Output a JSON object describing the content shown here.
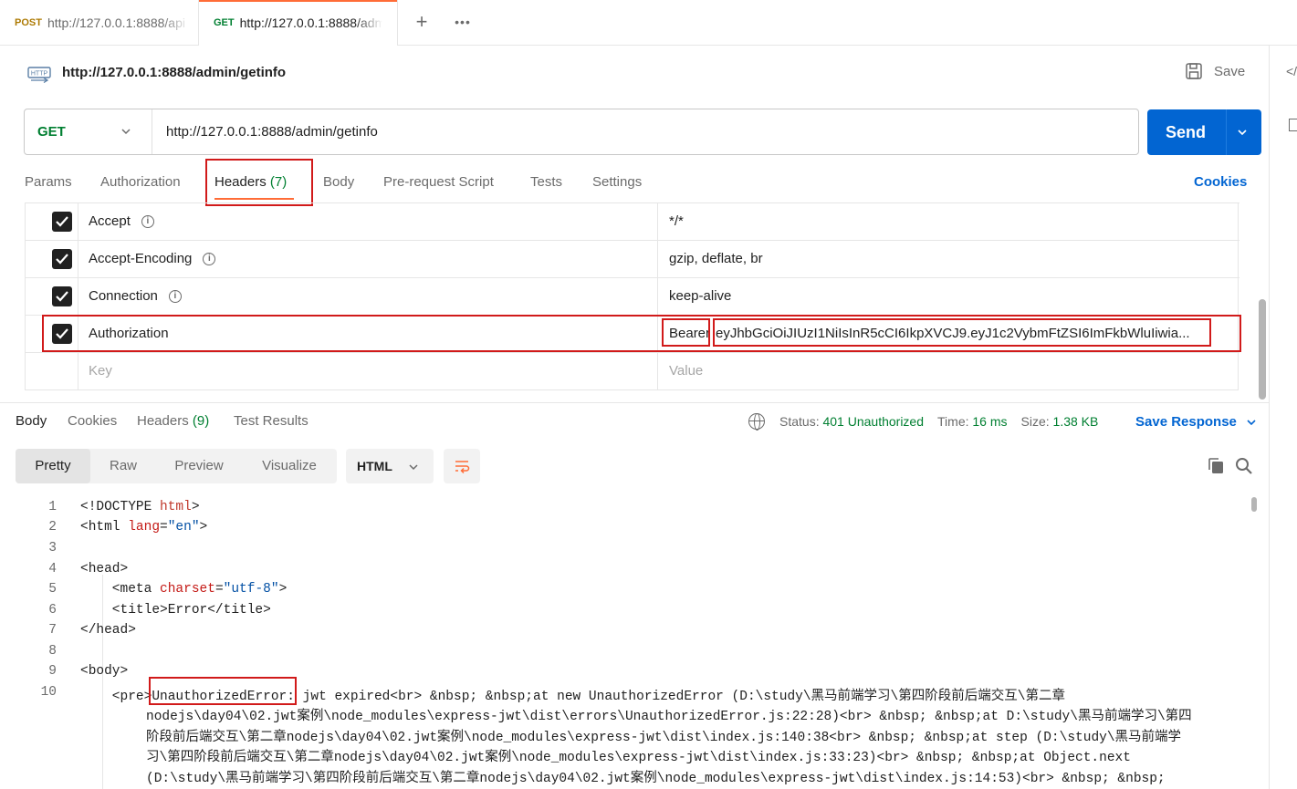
{
  "tabs": [
    {
      "method": "POST",
      "url": "http://127.0.0.1:8888/api"
    },
    {
      "method": "GET",
      "url": "http://127.0.0.1:8888/adm"
    }
  ],
  "tab_add_icon": "plus-icon",
  "tab_more_icon": "more-icon",
  "request": {
    "icon": "HTTP",
    "title": "http://127.0.0.1:8888/admin/getinfo",
    "save_label": "Save",
    "method": "GET",
    "url": "http://127.0.0.1:8888/admin/getinfo",
    "send_label": "Send"
  },
  "request_tabs": {
    "params": "Params",
    "authorization": "Authorization",
    "headers": "Headers",
    "headers_count": "(7)",
    "body": "Body",
    "prerequest": "Pre-request Script",
    "tests": "Tests",
    "settings": "Settings",
    "cookies": "Cookies"
  },
  "headers": [
    {
      "key": "Accept",
      "value": "*/*",
      "info": true,
      "checked": true
    },
    {
      "key": "Accept-Encoding",
      "value": "gzip, deflate, br",
      "info": true,
      "checked": true
    },
    {
      "key": "Connection",
      "value": "keep-alive",
      "info": true,
      "checked": true
    },
    {
      "key": "Authorization",
      "value_prefix": "Bearer",
      "value_token": "eyJhbGciOiJIUzI1NiIsInR5cCI6IkpXVCJ9.eyJ1c2VybmFtZSI6ImFkbWluIiwia...",
      "info": false,
      "checked": true
    }
  ],
  "header_placeholder": {
    "key": "Key",
    "value": "Value"
  },
  "response_tabs": {
    "body": "Body",
    "cookies": "Cookies",
    "headers": "Headers",
    "headers_count": "(9)",
    "test_results": "Test Results"
  },
  "response_status": {
    "status_label": "Status:",
    "status_value": "401 Unauthorized",
    "time_label": "Time:",
    "time_value": "16 ms",
    "size_label": "Size:",
    "size_value": "1.38 KB",
    "save_response": "Save Response"
  },
  "view_modes": [
    "Pretty",
    "Raw",
    "Preview",
    "Visualize"
  ],
  "format": "HTML",
  "code": {
    "line_numbers": [
      "1",
      "2",
      "3",
      "4",
      "5",
      "6",
      "7",
      "8",
      "9",
      "10"
    ],
    "l1_a": "<!DOCTYPE ",
    "l1_b": "html",
    "l1_c": ">",
    "l2_a": "<html ",
    "l2_b": "lang",
    "l2_c": "=",
    "l2_d": "\"en\"",
    "l2_e": ">",
    "l4": "<head>",
    "l5_a": "    <meta ",
    "l5_b": "charset",
    "l5_c": "=",
    "l5_d": "\"utf-8\"",
    "l5_e": ">",
    "l6": "    <title>Error</title>",
    "l7": "</head>",
    "l9": "<body>",
    "l10_a": "    <pre>",
    "l10_b": "UnauthorizedError",
    "l10_c": ": jwt expired<br> &nbsp; &nbsp;at new UnauthorizedError (D:\\study\\黑马前端学习\\第四阶段前后端交互\\第二章",
    "c1": "nodejs\\day04\\02.jwt案例\\node_modules\\express-jwt\\dist\\errors\\UnauthorizedError.js:22:28)<br> &nbsp; &nbsp;at D:\\study\\黑马前端学习\\第四",
    "c2": "阶段前后端交互\\第二章nodejs\\day04\\02.jwt案例\\node_modules\\express-jwt\\dist\\index.js:140:38<br> &nbsp; &nbsp;at step (D:\\study\\黑马前端学",
    "c3": "习\\第四阶段前后端交互\\第二章nodejs\\day04\\02.jwt案例\\node_modules\\express-jwt\\dist\\index.js:33:23)<br> &nbsp; &nbsp;at Object.next",
    "c4": "(D:\\study\\黑马前端学习\\第四阶段前后端交互\\第二章nodejs\\day04\\02.jwt案例\\node_modules\\express-jwt\\dist\\index.js:14:53)<br> &nbsp; &nbsp;"
  },
  "colors": {
    "accent": "#ff6c37",
    "send": "#0265d2",
    "get": "#007f31",
    "post": "#ad7a03",
    "highlight": "#d11a1a"
  }
}
